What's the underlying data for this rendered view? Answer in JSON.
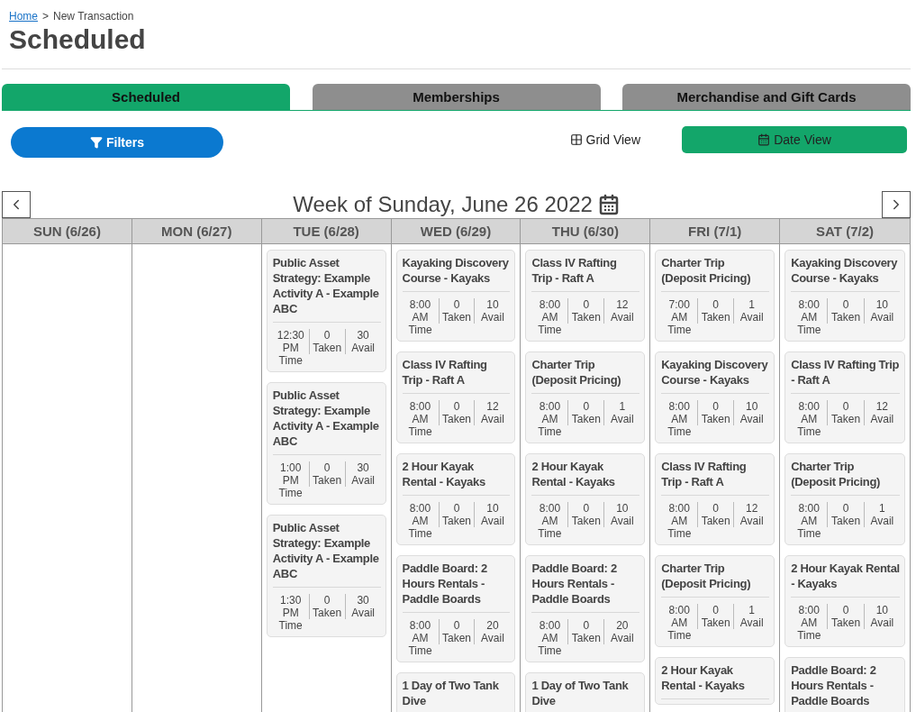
{
  "breadcrumb": {
    "home": "Home",
    "separator": ">",
    "current": "New Transaction"
  },
  "title": "Scheduled",
  "tabs": [
    {
      "label": "Scheduled",
      "selected": true
    },
    {
      "label": "Memberships",
      "selected": false
    },
    {
      "label": "Merchandise and Gift Cards",
      "selected": false
    }
  ],
  "filters_button": "Filters",
  "views": [
    {
      "kind": "grid",
      "label": "Grid View",
      "selected": false
    },
    {
      "kind": "date",
      "label": "Date View",
      "selected": true
    }
  ],
  "week_title": "Week of Sunday, June 26 2022",
  "days": [
    {
      "label": "SUN (6/26)"
    },
    {
      "label": "MON (6/27)"
    },
    {
      "label": "TUE (6/28)",
      "events": [
        {
          "title": "Public Asset Strategy: Example Activity A - Example ABC",
          "stats": [
            {
              "value": "12:30 PM",
              "label": "Time"
            },
            {
              "value": "0",
              "label": "Taken"
            },
            {
              "value": "30",
              "label": "Avail"
            }
          ]
        },
        {
          "title": "Public Asset Strategy: Example Activity A - Example ABC",
          "stats": [
            {
              "value": "1:00 PM",
              "label": "Time"
            },
            {
              "value": "0",
              "label": "Taken"
            },
            {
              "value": "30",
              "label": "Avail"
            }
          ]
        },
        {
          "title": "Public Asset Strategy: Example Activity A - Example ABC",
          "stats": [
            {
              "value": "1:30 PM",
              "label": "Time"
            },
            {
              "value": "0",
              "label": "Taken"
            },
            {
              "value": "30",
              "label": "Avail"
            }
          ]
        }
      ]
    },
    {
      "label": "WED (6/29)",
      "events": [
        {
          "title": "Kayaking Discovery Course - Kayaks",
          "stats": [
            {
              "value": "8:00 AM",
              "label": "Time"
            },
            {
              "value": "0",
              "label": "Taken"
            },
            {
              "value": "10",
              "label": "Avail"
            }
          ]
        },
        {
          "title": "Class IV Rafting Trip - Raft A",
          "stats": [
            {
              "value": "8:00 AM",
              "label": "Time"
            },
            {
              "value": "0",
              "label": "Taken"
            },
            {
              "value": "12",
              "label": "Avail"
            }
          ]
        },
        {
          "title": "2 Hour Kayak Rental - Kayaks",
          "stats": [
            {
              "value": "8:00 AM",
              "label": "Time"
            },
            {
              "value": "0",
              "label": "Taken"
            },
            {
              "value": "10",
              "label": "Avail"
            }
          ]
        },
        {
          "title": "Paddle Board: 2 Hours Rentals - Paddle Boards",
          "stats": [
            {
              "value": "8:00 AM",
              "label": "Time"
            },
            {
              "value": "0",
              "label": "Taken"
            },
            {
              "value": "20",
              "label": "Avail"
            }
          ]
        },
        {
          "title": "1 Day of Two Tank Dive"
        }
      ]
    },
    {
      "label": "THU (6/30)",
      "events": [
        {
          "title": "Class IV Rafting Trip - Raft A",
          "stats": [
            {
              "value": "8:00 AM",
              "label": "Time"
            },
            {
              "value": "0",
              "label": "Taken"
            },
            {
              "value": "12",
              "label": "Avail"
            }
          ]
        },
        {
          "title": "Charter Trip (Deposit Pricing)",
          "stats": [
            {
              "value": "8:00 AM",
              "label": "Time"
            },
            {
              "value": "0",
              "label": "Taken"
            },
            {
              "value": "1",
              "label": "Avail"
            }
          ]
        },
        {
          "title": "2 Hour Kayak Rental - Kayaks",
          "stats": [
            {
              "value": "8:00 AM",
              "label": "Time"
            },
            {
              "value": "0",
              "label": "Taken"
            },
            {
              "value": "10",
              "label": "Avail"
            }
          ]
        },
        {
          "title": "Paddle Board: 2 Hours Rentals - Paddle Boards",
          "stats": [
            {
              "value": "8:00 AM",
              "label": "Time"
            },
            {
              "value": "0",
              "label": "Taken"
            },
            {
              "value": "20",
              "label": "Avail"
            }
          ]
        },
        {
          "title": "1 Day of Two Tank Dive"
        }
      ]
    },
    {
      "label": "FRI (7/1)",
      "events": [
        {
          "title": "Charter Trip (Deposit Pricing)",
          "stats": [
            {
              "value": "7:00 AM",
              "label": "Time"
            },
            {
              "value": "0",
              "label": "Taken"
            },
            {
              "value": "1",
              "label": "Avail"
            }
          ]
        },
        {
          "title": "Kayaking Discovery Course - Kayaks",
          "stats": [
            {
              "value": "8:00 AM",
              "label": "Time"
            },
            {
              "value": "0",
              "label": "Taken"
            },
            {
              "value": "10",
              "label": "Avail"
            }
          ]
        },
        {
          "title": "Class IV Rafting Trip - Raft A",
          "stats": [
            {
              "value": "8:00 AM",
              "label": "Time"
            },
            {
              "value": "0",
              "label": "Taken"
            },
            {
              "value": "12",
              "label": "Avail"
            }
          ]
        },
        {
          "title": "Charter Trip (Deposit Pricing)",
          "stats": [
            {
              "value": "8:00 AM",
              "label": "Time"
            },
            {
              "value": "0",
              "label": "Taken"
            },
            {
              "value": "1",
              "label": "Avail"
            }
          ]
        },
        {
          "title": "2 Hour Kayak Rental - Kayaks"
        }
      ]
    },
    {
      "label": "SAT (7/2)",
      "events": [
        {
          "title": "Kayaking Discovery Course - Kayaks",
          "stats": [
            {
              "value": "8:00 AM",
              "label": "Time"
            },
            {
              "value": "0",
              "label": "Taken"
            },
            {
              "value": "10",
              "label": "Avail"
            }
          ]
        },
        {
          "title": "Class IV Rafting Trip - Raft A",
          "stats": [
            {
              "value": "8:00 AM",
              "label": "Time"
            },
            {
              "value": "0",
              "label": "Taken"
            },
            {
              "value": "12",
              "label": "Avail"
            }
          ]
        },
        {
          "title": "Charter Trip (Deposit Pricing)",
          "stats": [
            {
              "value": "8:00 AM",
              "label": "Time"
            },
            {
              "value": "0",
              "label": "Taken"
            },
            {
              "value": "1",
              "label": "Avail"
            }
          ]
        },
        {
          "title": "2 Hour Kayak Rental - Kayaks",
          "stats": [
            {
              "value": "8:00 AM",
              "label": "Time"
            },
            {
              "value": "0",
              "label": "Taken"
            },
            {
              "value": "10",
              "label": "Avail"
            }
          ]
        },
        {
          "title": "Paddle Board: 2 Hours Rentals - Paddle Boards"
        }
      ]
    }
  ]
}
